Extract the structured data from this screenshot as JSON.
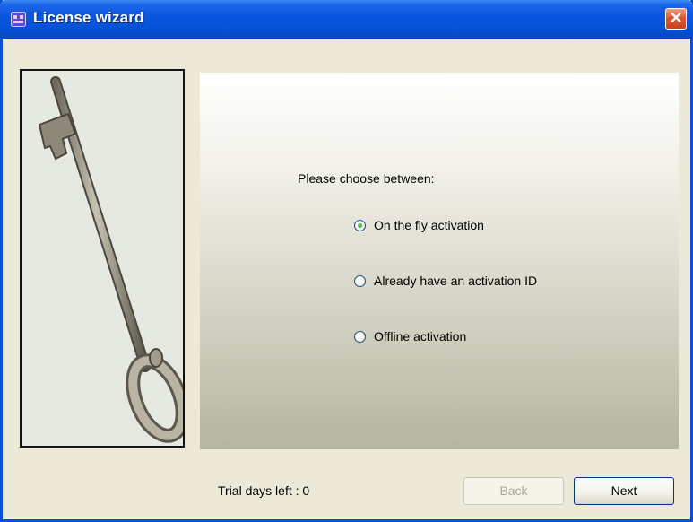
{
  "window": {
    "title": "License wizard"
  },
  "content": {
    "prompt": "Please choose between:",
    "options": [
      {
        "label": "On the fly activation",
        "selected": true
      },
      {
        "label": "Already have an activation ID",
        "selected": false
      },
      {
        "label": "Offline activation",
        "selected": false
      }
    ]
  },
  "footer": {
    "trial_text": "Trial days left : 0",
    "back_label": "Back",
    "next_label": "Next",
    "back_enabled": false
  },
  "colors": {
    "titlebar": "#0553d9",
    "close_button": "#e0552f",
    "panel_gradient_bottom": "#b5b3a1",
    "radio_dot": "#21a121"
  },
  "icons": {
    "app_icon": "license-app-icon",
    "close": "close-icon",
    "image": "skeleton-key-illustration"
  }
}
